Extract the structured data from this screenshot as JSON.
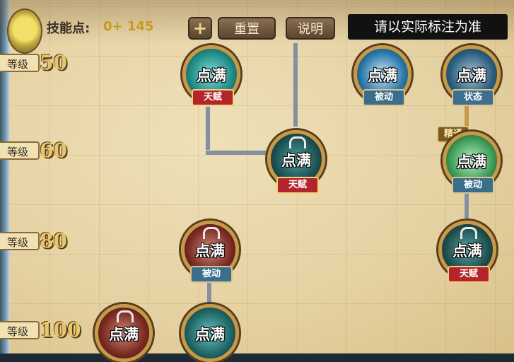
{
  "header": {
    "skill_points_label": "技能点:",
    "skill_points_value": "0+ 145",
    "plus_label": "+",
    "reset_label": "重置",
    "help_label": "说明",
    "caption": "请以实际标注为准"
  },
  "levels": [
    {
      "tag": "等级",
      "value": "50"
    },
    {
      "tag": "等级",
      "value": "60"
    },
    {
      "tag": "等级",
      "value": "80"
    },
    {
      "tag": "等级",
      "value": "100"
    }
  ],
  "nodes": [
    {
      "label": "点满",
      "badge": "天赋",
      "badge_type": "talent",
      "color": "#1f8a86"
    },
    {
      "label": "点满",
      "badge": "被动",
      "badge_type": "passive",
      "color": "#2a78a8"
    },
    {
      "label": "点满",
      "badge": "状态",
      "badge_type": "state",
      "color": "#2b5f7f"
    },
    {
      "label": "点满",
      "badge": "天赋",
      "badge_type": "talent",
      "color": "#1e5050"
    },
    {
      "label": "点满",
      "badge": "被动",
      "badge_type": "passive",
      "color": "#3e9b56",
      "top_badge": "精通"
    },
    {
      "label": "点满",
      "badge": "被动",
      "badge_type": "passive",
      "color": "#7b2a24"
    },
    {
      "label": "点满",
      "badge": "天赋",
      "badge_type": "talent",
      "color": "#1f4f4e"
    },
    {
      "label": "点满",
      "badge": "",
      "badge_type": "",
      "color": "#7a2a22"
    },
    {
      "label": "点满",
      "badge": "",
      "badge_type": "",
      "color": "#1f6666"
    }
  ]
}
